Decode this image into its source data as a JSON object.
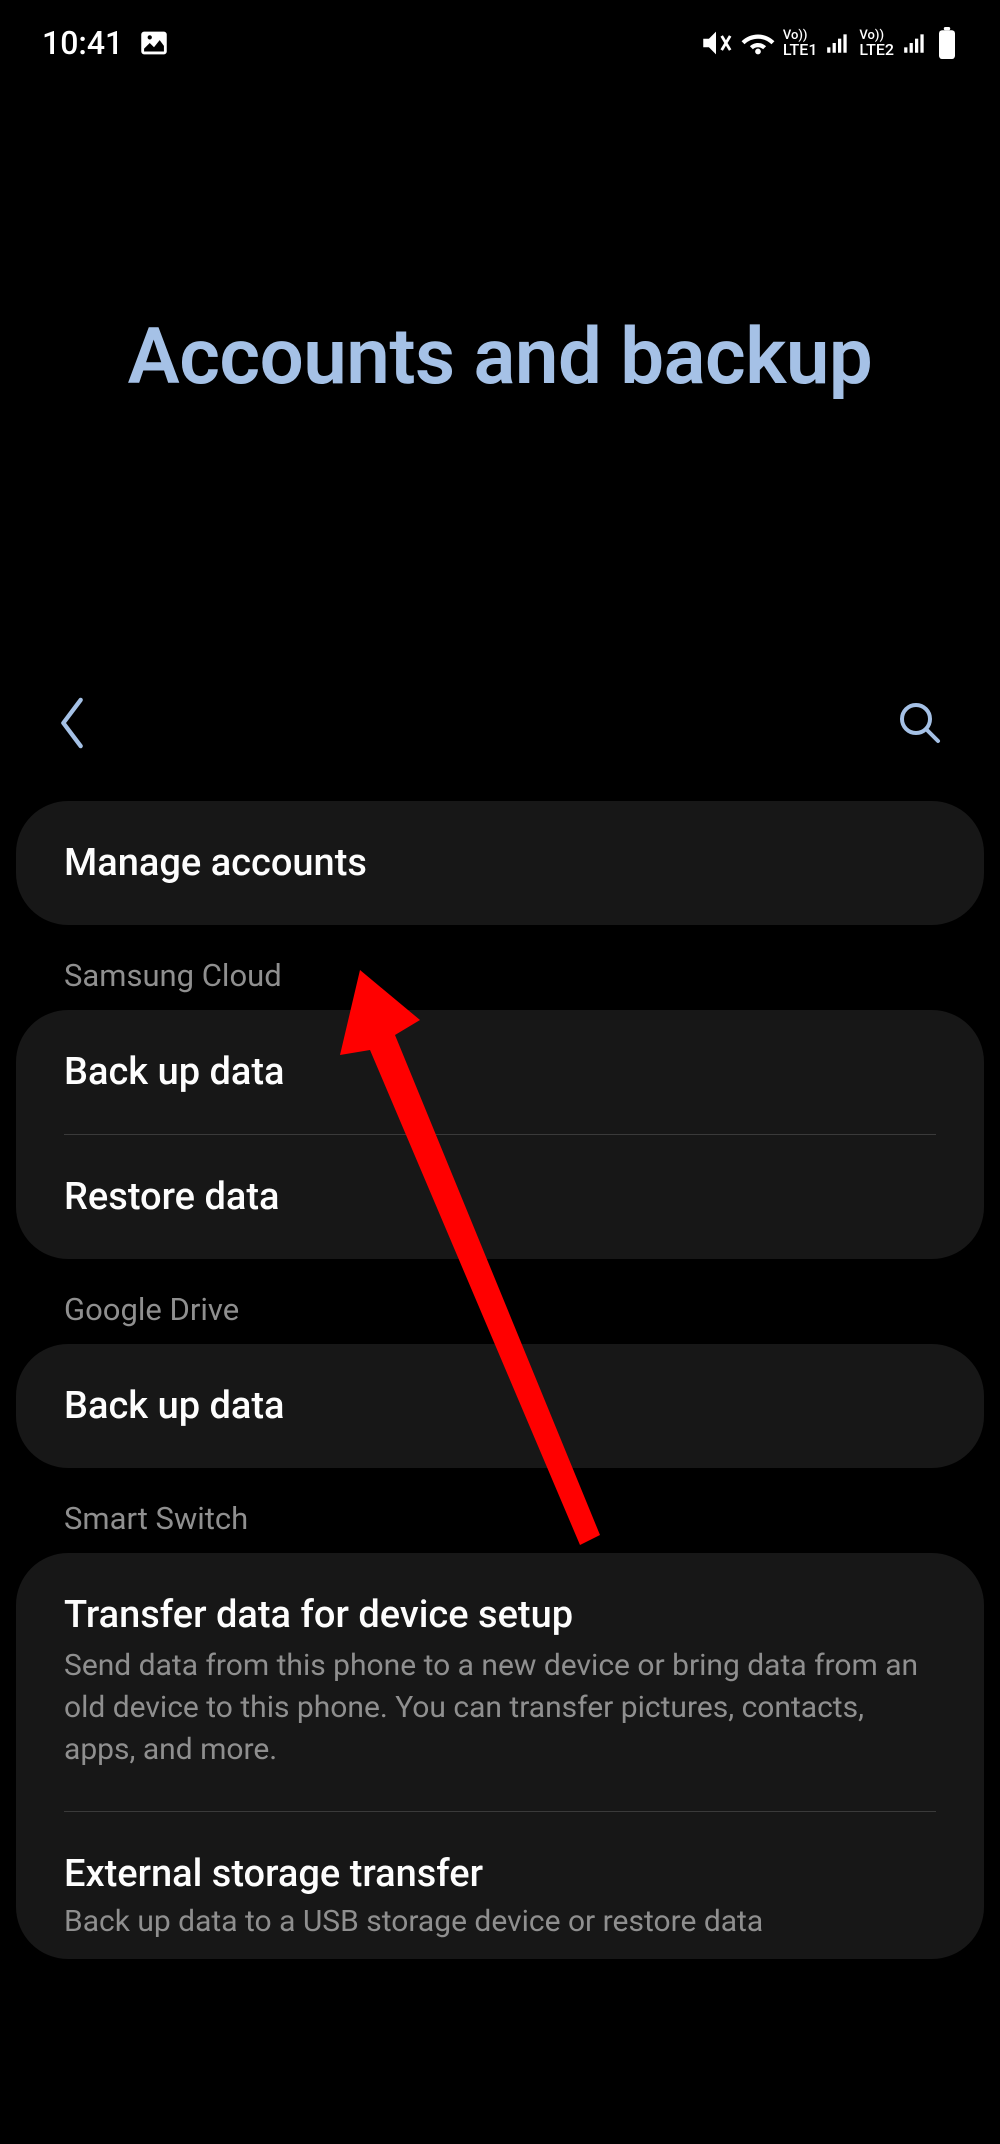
{
  "statusBar": {
    "time": "10:41",
    "sim1": "LTE1",
    "sim2": "LTE2",
    "vo1": "Vo))",
    "vo2": "Vo))"
  },
  "page": {
    "title": "Accounts and backup"
  },
  "items": {
    "manageAccounts": "Manage accounts"
  },
  "sections": {
    "samsungCloud": {
      "header": "Samsung Cloud",
      "backup": "Back up data",
      "restore": "Restore data"
    },
    "googleDrive": {
      "header": "Google Drive",
      "backup": "Back up data"
    },
    "smartSwitch": {
      "header": "Smart Switch",
      "transfer": {
        "title": "Transfer data for device setup",
        "subtitle": "Send data from this phone to a new device or bring data from an old device to this phone. You can transfer pictures, contacts, apps, and more."
      },
      "external": {
        "title": "External storage transfer",
        "subtitle": "Back up data to a USB storage device or restore data"
      }
    }
  }
}
